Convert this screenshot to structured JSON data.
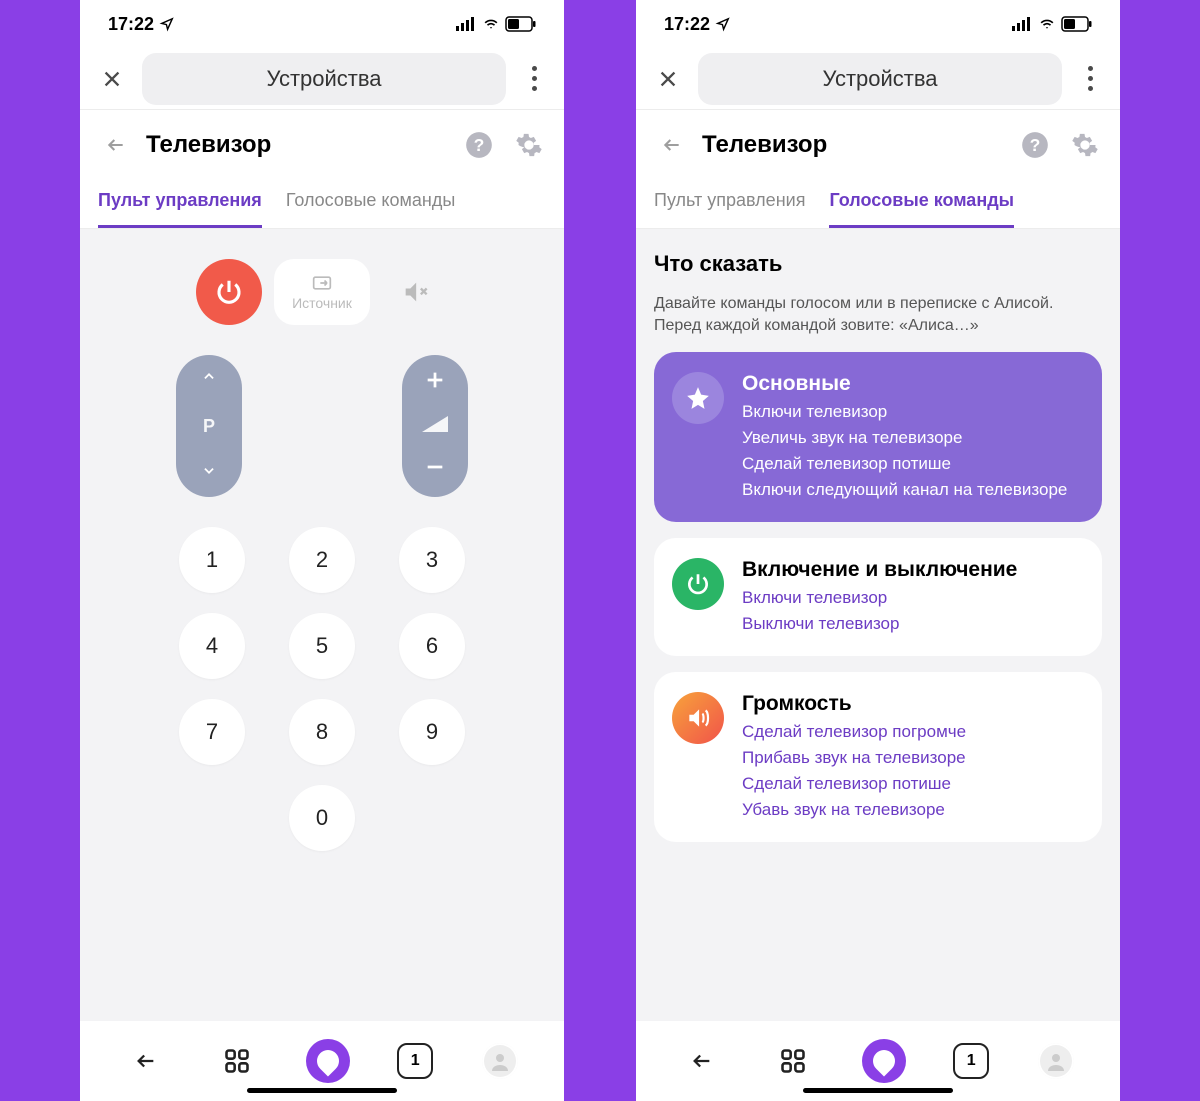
{
  "statusbar": {
    "time": "17:22"
  },
  "toprow": {
    "search_label": "Устройства"
  },
  "page": {
    "title": "Телевизор"
  },
  "tabs": {
    "remote": "Пульт управления",
    "voice": "Голосовые команды"
  },
  "remote": {
    "source_label": "Источник",
    "channel_letter": "P",
    "digits": [
      "1",
      "2",
      "3",
      "4",
      "5",
      "6",
      "7",
      "8",
      "9",
      "0"
    ]
  },
  "voice": {
    "heading": "Что сказать",
    "description": "Давайте команды голосом или в переписке с Алисой. Перед каждой командой зовите: «Алиса…»",
    "groups": [
      {
        "title": "Основные",
        "lines": [
          "Включи телевизор",
          "Увеличь звук на телевизоре",
          "Сделай телевизор потише",
          "Включи следующий канал на телевизоре"
        ]
      },
      {
        "title": "Включение и выключение",
        "lines": [
          "Включи телевизор",
          "Выключи телевизор"
        ]
      },
      {
        "title": "Громкость",
        "lines": [
          "Сделай телевизор погромче",
          "Прибавь звук на телевизоре",
          "Сделай телевизор потише",
          "Убавь звук на телевизоре"
        ]
      }
    ]
  },
  "bottomnav": {
    "tab_count": "1"
  }
}
